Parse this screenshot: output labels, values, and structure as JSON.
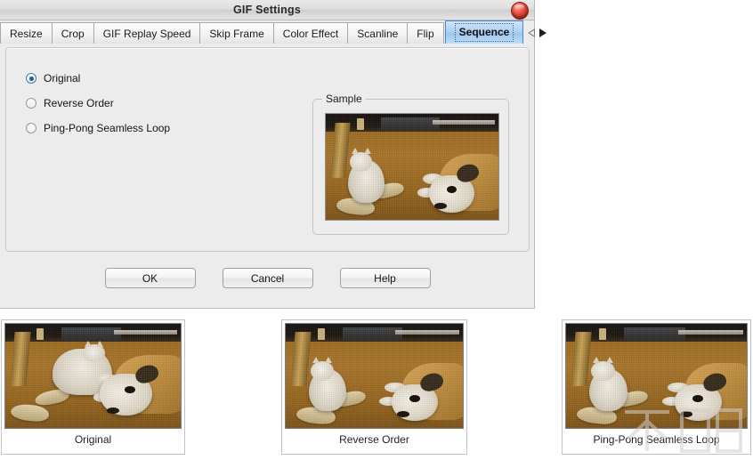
{
  "dialog": {
    "title": "GIF Settings",
    "close_icon": "close-orb-icon",
    "tabs": [
      {
        "label": "Resize",
        "active": false
      },
      {
        "label": "Crop",
        "active": false
      },
      {
        "label": "GIF Replay Speed",
        "active": false
      },
      {
        "label": "Skip Frame",
        "active": false
      },
      {
        "label": "Color Effect",
        "active": false
      },
      {
        "label": "Scanline",
        "active": false
      },
      {
        "label": "Flip",
        "active": false
      },
      {
        "label": "Sequence",
        "active": true
      }
    ],
    "tab_scroll_left_icon": "triangle-left-icon",
    "tab_scroll_right_icon": "triangle-right-icon",
    "options": [
      {
        "label": "Original",
        "checked": true
      },
      {
        "label": "Reverse Order",
        "checked": false
      },
      {
        "label": "Ping-Pong Seamless Loop",
        "checked": false
      }
    ],
    "sample": {
      "legend": "Sample"
    },
    "buttons": [
      {
        "label": "OK"
      },
      {
        "label": "Cancel"
      },
      {
        "label": "Help"
      }
    ]
  },
  "previews": [
    {
      "caption": "Original"
    },
    {
      "caption": "Reverse Order"
    },
    {
      "caption": "Ping-Pong Seamless Loop"
    }
  ],
  "colors": {
    "dialog_background": "#ececed",
    "panel_background": "#ececec",
    "active_tab_blue": "#aed0f0",
    "active_tab_border": "#4a86c8",
    "radio_dot": "#1f5c96",
    "close_button_red": "#e8584a",
    "page_background": "#ffffff"
  }
}
